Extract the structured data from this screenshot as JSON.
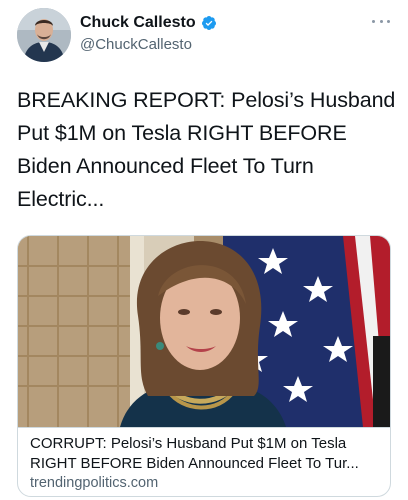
{
  "author": {
    "display_name": "Chuck Callesto",
    "handle": "@ChuckCallesto",
    "verified": true,
    "verified_color": "#1d9bf0",
    "avatar_icon": "user-avatar-photo"
  },
  "tweet": {
    "text": "BREAKING REPORT: Pelosi’s Husband Put $1M on Tesla RIGHT BEFORE Biden Announced Fleet To Turn Electric..."
  },
  "menu": {
    "icon": "more-horizontal-icon"
  },
  "link_card": {
    "image_icon": "article-photo",
    "title": "CORRUPT: Pelosi’s Husband Put $1M on Tesla\nRIGHT BEFORE Biden Announced Fleet To Tur...",
    "domain": "trendingpolitics.com"
  },
  "colors": {
    "text": "#0f1419",
    "secondary": "#536471",
    "border": "#cfd9de",
    "verified": "#1d9bf0"
  }
}
